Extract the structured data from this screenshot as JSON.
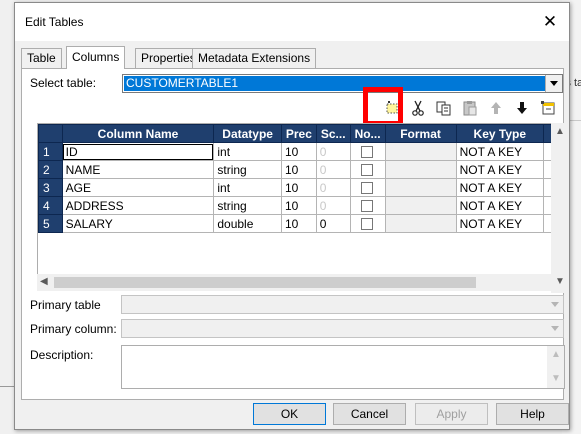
{
  "background": {
    "peek_text": "is ta"
  },
  "dialog": {
    "title": "Edit Tables",
    "close_glyph": "✕",
    "tabs": [
      {
        "label": "Table"
      },
      {
        "label": "Columns",
        "active": true
      },
      {
        "label": "Properties"
      },
      {
        "label": "Metadata Extensions"
      }
    ],
    "select_table": {
      "label": "Select table:",
      "value": "CUSTOMERTABLE1"
    },
    "toolbar": {
      "icons": [
        "new-column-icon",
        "cut-icon",
        "copy-icon",
        "paste-icon",
        "move-up-icon",
        "move-down-icon",
        "import-icon"
      ],
      "highlighted": "new-column-icon",
      "highlight_color": "#ff0000"
    },
    "grid": {
      "columns": [
        "Column Name",
        "Datatype",
        "Prec",
        "Sc...",
        "No...",
        "Format",
        "Key Type"
      ],
      "rows": [
        {
          "num": "1",
          "name": "ID",
          "datatype": "int",
          "prec": "10",
          "scale": "0",
          "not_null": false,
          "format": "",
          "key_type": "NOT A KEY"
        },
        {
          "num": "2",
          "name": "NAME",
          "datatype": "string",
          "prec": "10",
          "scale": "0",
          "not_null": false,
          "format": "",
          "key_type": "NOT A KEY"
        },
        {
          "num": "3",
          "name": "AGE",
          "datatype": "int",
          "prec": "10",
          "scale": "0",
          "not_null": false,
          "format": "",
          "key_type": "NOT A KEY"
        },
        {
          "num": "4",
          "name": "ADDRESS",
          "datatype": "string",
          "prec": "10",
          "scale": "0",
          "not_null": false,
          "format": "",
          "key_type": "NOT A KEY"
        },
        {
          "num": "5",
          "name": "SALARY",
          "datatype": "double",
          "prec": "10",
          "scale": "0",
          "not_null": false,
          "format": "",
          "key_type": "NOT A KEY"
        }
      ]
    },
    "primary_table": {
      "label": "Primary table",
      "value": ""
    },
    "primary_column": {
      "label": "Primary column:",
      "value": ""
    },
    "description": {
      "label": "Description:",
      "value": ""
    },
    "buttons": {
      "ok": "OK",
      "cancel": "Cancel",
      "apply": "Apply",
      "help": "Help"
    },
    "colors": {
      "header_bg": "#1f3f6e",
      "selection": "#0078d7"
    }
  }
}
